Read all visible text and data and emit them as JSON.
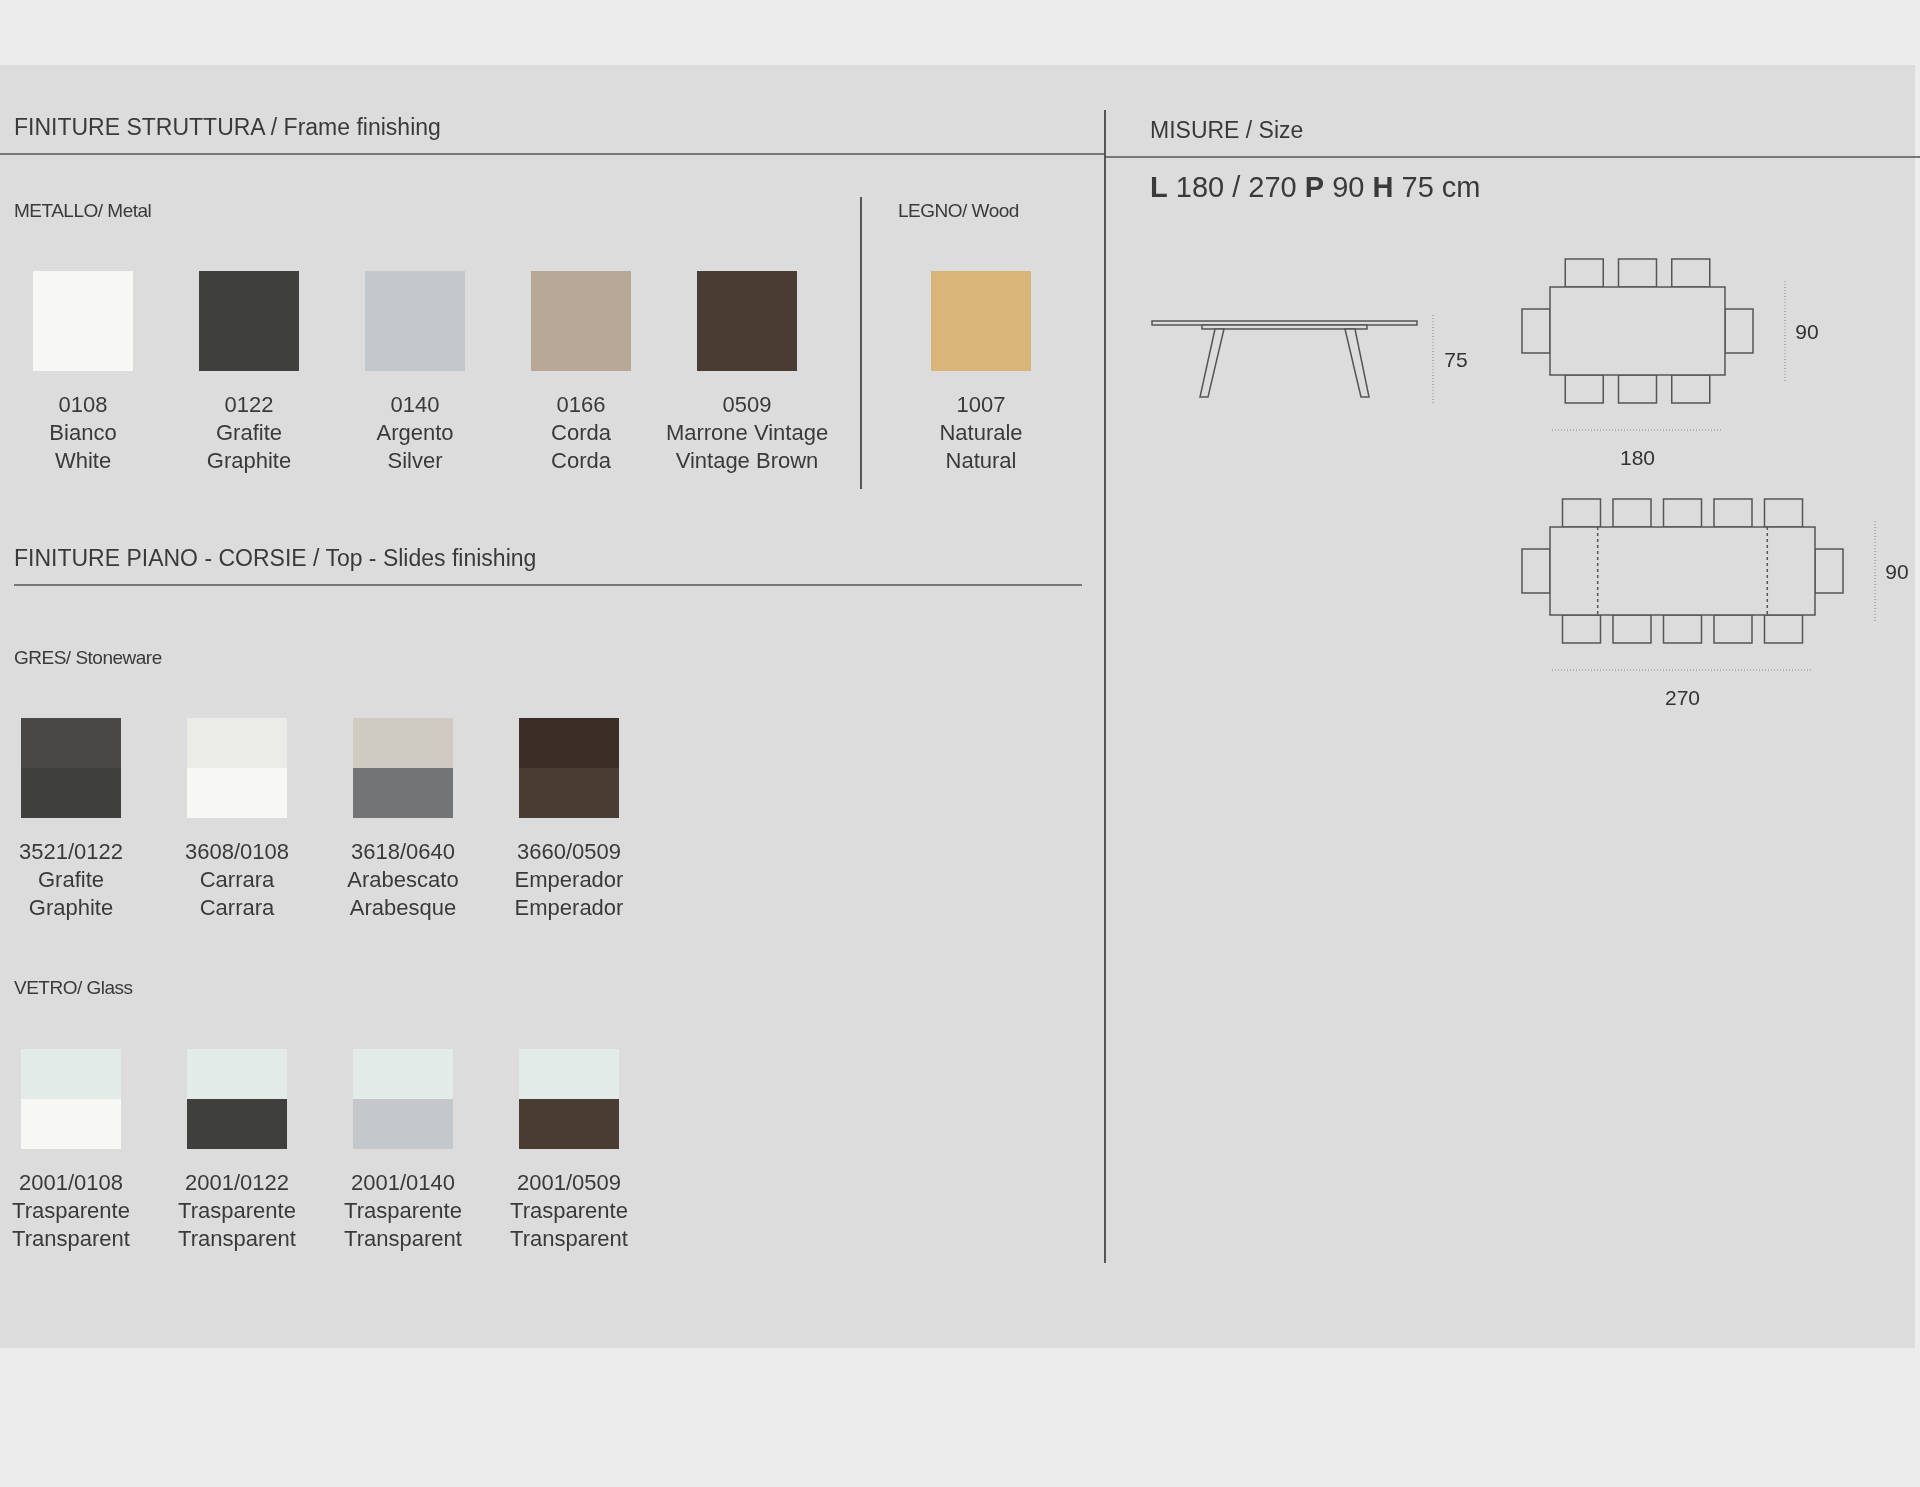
{
  "frame_finishing": {
    "title": "FINITURE STRUTTURA / Frame finishing",
    "groups": [
      {
        "title": "METALLO/ Metal",
        "swatches": [
          {
            "code": "0108",
            "name_it": "Bianco",
            "name_en": "White",
            "color": "#f7f7f5"
          },
          {
            "code": "0122",
            "name_it": "Grafite",
            "name_en": "Graphite",
            "color": "#3f3f3d"
          },
          {
            "code": "0140",
            "name_it": "Argento",
            "name_en": "Silver",
            "color": "#c5c8ca"
          },
          {
            "code": "0166",
            "name_it": "Corda",
            "name_en": "Corda",
            "color": "#b7a796"
          },
          {
            "code": "0509",
            "name_it": "Marrone Vintage",
            "name_en": "Vintage Brown",
            "color": "#483c33"
          }
        ]
      },
      {
        "title": "LEGNO/ Wood",
        "swatches": [
          {
            "code": "1007",
            "name_it": "Naturale",
            "name_en": "Natural",
            "color": "#d8b67a"
          }
        ]
      }
    ]
  },
  "top_finishing": {
    "title": "FINITURE PIANO - CORSIE / Top - Slides finishing",
    "groups": [
      {
        "title": "GRES/ Stoneware",
        "swatches": [
          {
            "code": "3521/0122",
            "name_it": "Grafite",
            "name_en": "Graphite",
            "top_half": {
              "color": "#4a4846"
            },
            "color": "#3f3f3d"
          },
          {
            "code": "3608/0108",
            "name_it": "Carrara",
            "name_en": "Carrara",
            "top_half": {
              "color": "#ebebe7"
            },
            "color": "#f7f7f5"
          },
          {
            "code": "3618/0640",
            "name_it": "Arabescato",
            "name_en": "Arabesque",
            "top_half": {
              "color": "#cfcbc3"
            },
            "color": "#727476"
          },
          {
            "code": "3660/0509",
            "name_it": "Emperador",
            "name_en": "Emperador",
            "top_half": {
              "color": "#3a2e26"
            },
            "color": "#483c33"
          }
        ]
      },
      {
        "title": "VETRO/ Glass",
        "swatches": [
          {
            "code": "2001/0108",
            "name_it": "Trasparente",
            "name_en": "Transparent",
            "top_half": {
              "color": "#e3ebe8"
            },
            "color": "#f7f7f5"
          },
          {
            "code": "2001/0122",
            "name_it": "Trasparente",
            "name_en": "Transparent",
            "top_half": {
              "color": "#e3ebe8"
            },
            "color": "#3f3f3d"
          },
          {
            "code": "2001/0140",
            "name_it": "Trasparente",
            "name_en": "Transparent",
            "top_half": {
              "color": "#e3ebe8"
            },
            "color": "#c5c8ca"
          },
          {
            "code": "2001/0509",
            "name_it": "Trasparente",
            "name_en": "Transparent",
            "top_half": {
              "color": "#e3ebe8"
            },
            "color": "#483c33"
          }
        ]
      }
    ]
  },
  "size": {
    "title": "MISURE / Size",
    "dimensions": "**L** 180 / 270 **P** 90 **H** 75 cm",
    "drawings": [
      {
        "kind": "side",
        "height_label": "75"
      },
      {
        "kind": "top",
        "width_label": "180",
        "depth_label": "90"
      },
      {
        "kind": "extended",
        "width_label": "270",
        "depth_label": "90"
      }
    ]
  }
}
